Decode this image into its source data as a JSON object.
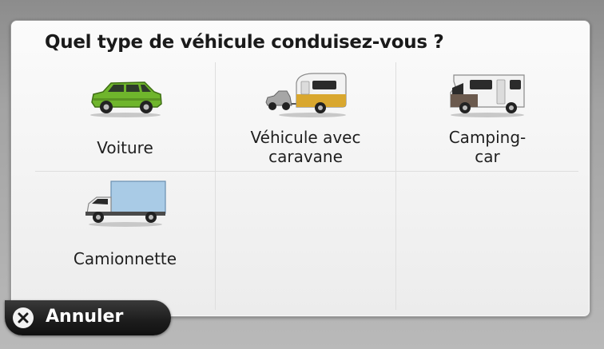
{
  "dialog": {
    "title": "Quel type de véhicule conduisez-vous ?"
  },
  "options": [
    {
      "label": "Voiture",
      "icon": "car-icon",
      "color": "#6fb52c"
    },
    {
      "label": "Véhicule avec\ncaravane",
      "icon": "car-with-caravan-icon",
      "color": "#d9a72e"
    },
    {
      "label": "Camping-\ncar",
      "icon": "camper-van-icon",
      "color": "#6b5a4e"
    },
    {
      "label": "Camionnette",
      "icon": "van-icon",
      "color": "#a9cbe6"
    }
  ],
  "cancel": {
    "label": "Annuler",
    "icon": "close-icon"
  }
}
